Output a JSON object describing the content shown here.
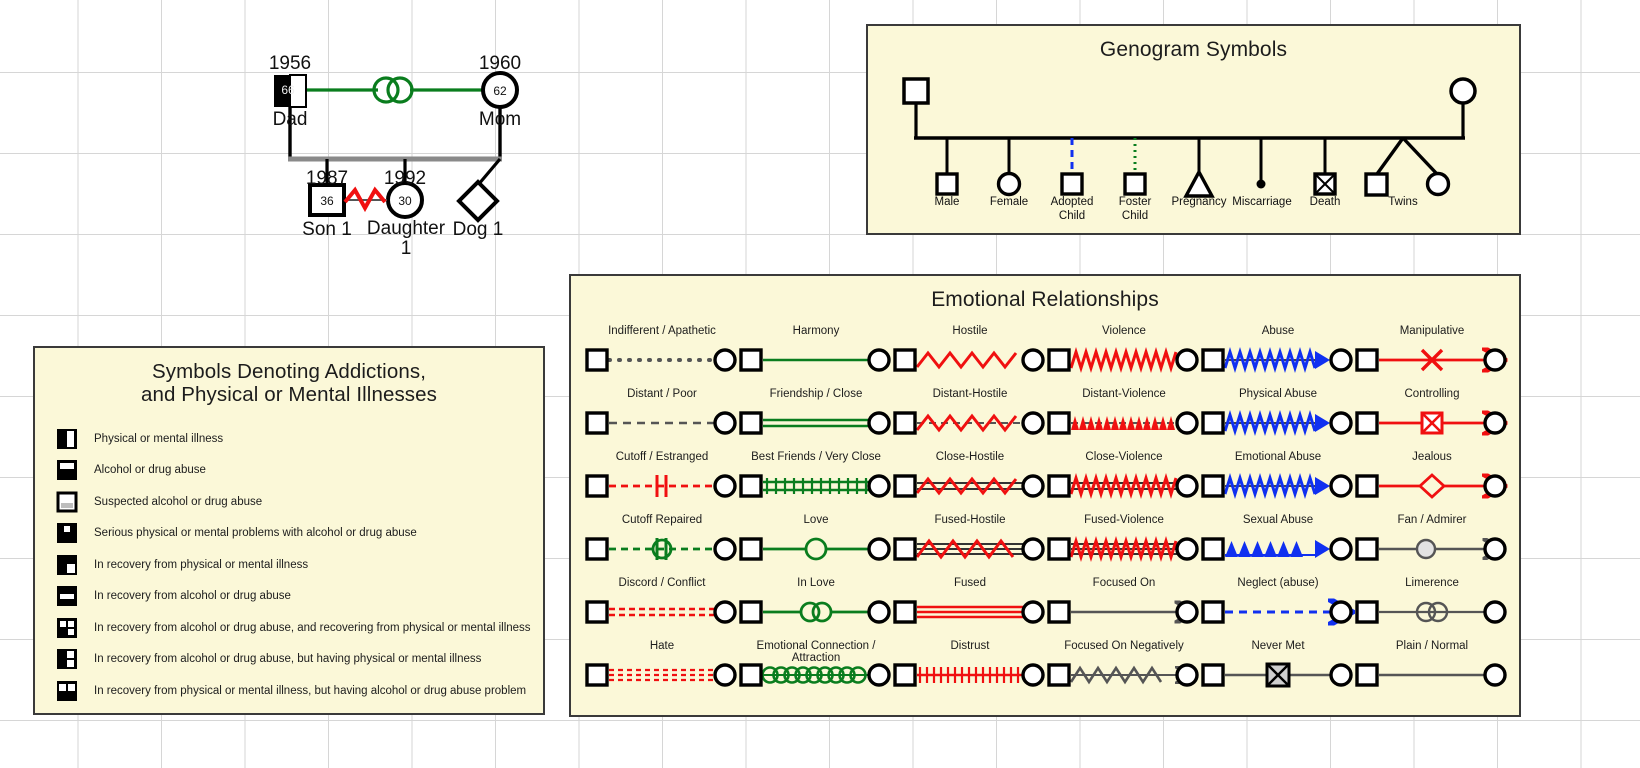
{
  "canvas": {
    "background": "#ffffff",
    "grid_color": "#d6d6d6"
  },
  "palette": {
    "panel_fill": "#fbf8d8",
    "panel_border": "#3a3a3a",
    "green": "#0a7d1e",
    "red": "#f01010",
    "blue": "#1030f0",
    "gray": "#555555",
    "black": "#000000"
  },
  "family_tree": {
    "name": "family-genogram",
    "father": {
      "label": "Dad",
      "year": "1956",
      "age": "66",
      "symbol": "square",
      "marking": "physical-or-mental-illness"
    },
    "mother": {
      "label": "Mom",
      "year": "1960",
      "age": "62",
      "symbol": "circle"
    },
    "marriage_line": {
      "style": "in-love",
      "color": "#0a7d1e"
    },
    "children": [
      {
        "label": "Son 1",
        "year": "1987",
        "age": "36",
        "symbol": "square"
      },
      {
        "label": "Daughter 1",
        "year": "1992",
        "age": "30",
        "symbol": "circle"
      },
      {
        "label": "Dog 1",
        "year": "",
        "age": "",
        "symbol": "diamond"
      }
    ],
    "sibling_relationship": {
      "between": "Son 1 / Daughter 1",
      "style": "hostile",
      "color": "#f01010"
    }
  },
  "symbols_panel": {
    "title": "Genogram Symbols",
    "items": [
      {
        "label": "Male",
        "shape": "square",
        "link": "solid-black"
      },
      {
        "label": "Female",
        "shape": "circle",
        "link": "solid-black"
      },
      {
        "label": "Adopted\nChild",
        "line1": "Adopted",
        "line2": "Child",
        "shape": "square",
        "link": "dashed-blue"
      },
      {
        "label": "Foster\nChild",
        "line1": "Foster",
        "line2": "Child",
        "shape": "square",
        "link": "dotted-green"
      },
      {
        "label": "Pregnancy",
        "shape": "triangle",
        "link": "solid-black"
      },
      {
        "label": "Miscarriage",
        "shape": "filled-dot",
        "link": "solid-black"
      },
      {
        "label": "Death",
        "shape": "square-with-x",
        "link": "solid-black"
      },
      {
        "label": "Twins",
        "shape": "square-and-circle",
        "link": "twin-fork"
      }
    ]
  },
  "addictions_panel": {
    "title_line1": "Symbols Denoting Addictions,",
    "title_line2": "and Physical or Mental Illnesses",
    "items": [
      {
        "label": "Physical or mental illness",
        "swatch": "black-with-white-right-half-bar"
      },
      {
        "label": "Alcohol or drug abuse",
        "swatch": "black-with-white-top-band"
      },
      {
        "label": "Suspected alcohol or drug abuse",
        "swatch": "white-with-gray-bottom-band"
      },
      {
        "label": "Serious physical or mental problems with alcohol or drug abuse",
        "swatch": "black-with-small-white-top-square"
      },
      {
        "label": "In recovery from physical or mental illness",
        "swatch": "black-with-white-lower-right-quadrant"
      },
      {
        "label": "In recovery from alcohol or drug abuse",
        "swatch": "black-with-white-middle-band"
      },
      {
        "label": "In recovery from alcohol or drug abuse, and recovering from physical or mental illness",
        "swatch": "black-with-white-cross-quadrants"
      },
      {
        "label": "In recovery from alcohol or drug abuse, but having physical or mental illness",
        "swatch": "black-with-white-right-stack"
      },
      {
        "label": "In recovery from physical or mental illness, but having alcohol or drug abuse problem",
        "swatch": "black-with-two-white-top-squares"
      }
    ]
  },
  "emotional_panel": {
    "title": "Emotional Relationships",
    "rows": [
      [
        {
          "label": "Indifferent / Apathetic",
          "style": "dotted",
          "color": "#555555"
        },
        {
          "label": "Harmony",
          "style": "solid",
          "color": "#0a7d1e"
        },
        {
          "label": "Hostile",
          "style": "zigzag-wide",
          "color": "#f01010"
        },
        {
          "label": "Violence",
          "style": "zigzag-tight",
          "color": "#f01010"
        },
        {
          "label": "Abuse",
          "style": "zigzag-tight-arrow",
          "color": "#1030f0"
        },
        {
          "label": "Manipulative",
          "style": "line-x-arrow",
          "color": "#f01010"
        }
      ],
      [
        {
          "label": "Distant / Poor",
          "style": "dashed",
          "color": "#555555"
        },
        {
          "label": "Friendship / Close",
          "style": "double-solid",
          "color": "#0a7d1e"
        },
        {
          "label": "Distant-Hostile",
          "style": "dashed-zigzag",
          "color": "#f01010"
        },
        {
          "label": "Distant-Violence",
          "style": "dashed-zigzag-tight",
          "color": "#f01010"
        },
        {
          "label": "Physical Abuse",
          "style": "zigzag-tight-arrow",
          "color": "#1030f0"
        },
        {
          "label": "Controlling",
          "style": "line-boxx-arrow",
          "color": "#f01010"
        }
      ],
      [
        {
          "label": "Cutoff / Estranged",
          "style": "dashed-break",
          "color": "#f01010"
        },
        {
          "label": "Best Friends / Very Close",
          "style": "ladder",
          "color": "#0a7d1e"
        },
        {
          "label": "Close-Hostile",
          "style": "solid-zigzag",
          "color": "#f01010"
        },
        {
          "label": "Close-Violence",
          "style": "solid-zigzag-tight",
          "color": "#f01010"
        },
        {
          "label": "Emotional Abuse",
          "style": "zigzag-tight-arrow",
          "color": "#1030f0"
        },
        {
          "label": "Jealous",
          "style": "line-diamond-arrow",
          "color": "#f01010"
        }
      ],
      [
        {
          "label": "Cutoff Repaired",
          "style": "dashed-repaired",
          "color": "#0a7d1e"
        },
        {
          "label": "Love",
          "style": "single-loop",
          "color": "#0a7d1e"
        },
        {
          "label": "Fused-Hostile",
          "style": "triple-zigzag",
          "color": "#f01010"
        },
        {
          "label": "Fused-Violence",
          "style": "triple-zigzag-tight",
          "color": "#f01010"
        },
        {
          "label": "Sexual Abuse",
          "style": "triangles-arrow",
          "color": "#1030f0"
        },
        {
          "label": "Fan / Admirer",
          "style": "gray-loop-arrow",
          "color": "#555555"
        }
      ],
      [
        {
          "label": "Discord / Conflict",
          "style": "double-dashed",
          "color": "#f01010"
        },
        {
          "label": "In Love",
          "style": "double-loop",
          "color": "#0a7d1e"
        },
        {
          "label": "Fused",
          "style": "triple-solid",
          "color": "#f01010"
        },
        {
          "label": "Focused On",
          "style": "solid-arrow",
          "color": "#555555"
        },
        {
          "label": "Neglect (abuse)",
          "style": "dashed-arrow",
          "color": "#1030f0"
        },
        {
          "label": "Limerence",
          "style": "gray-double-loop",
          "color": "#555555"
        }
      ],
      [
        {
          "label": "Hate",
          "style": "triple-dashed",
          "color": "#f01010"
        },
        {
          "label": "Emotional Connection /",
          "label2": "Attraction",
          "style": "loop-chain",
          "color": "#0a7d1e"
        },
        {
          "label": "Distrust",
          "style": "ladder-red",
          "color": "#f01010"
        },
        {
          "label": "Focused On Negatively",
          "style": "zigzag-gray-arrow",
          "color": "#555555"
        },
        {
          "label": "Never Met",
          "style": "line-boxx-gray",
          "color": "#555555"
        },
        {
          "label": "Plain / Normal",
          "style": "solid",
          "color": "#555555"
        }
      ]
    ]
  }
}
